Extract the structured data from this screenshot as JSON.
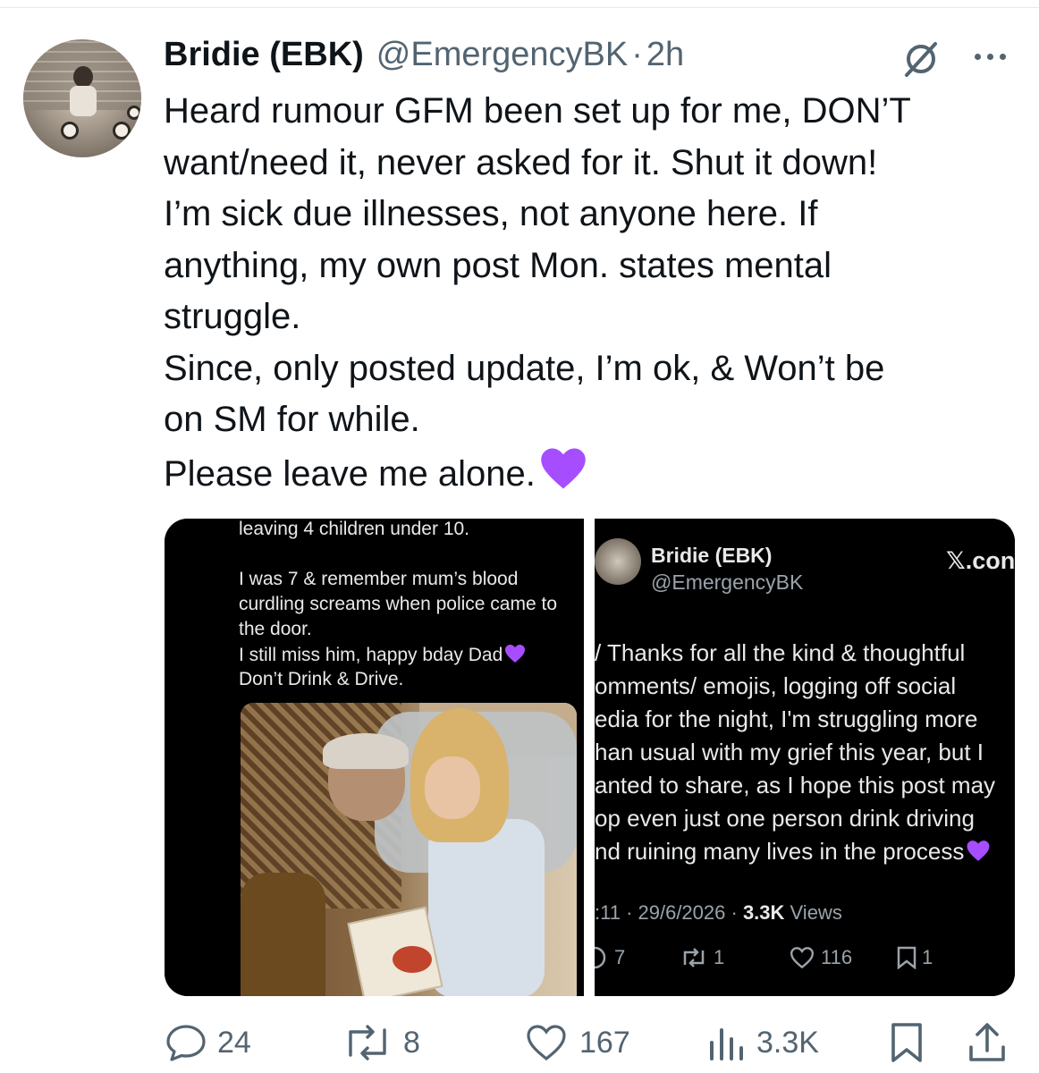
{
  "author": {
    "name": "Bridie (EBK)",
    "handle": "@EmergencyBK",
    "separator": "·",
    "time": "2h"
  },
  "tweet": {
    "lines": [
      "Heard rumour GFM been set up for me, DON’T",
      "want/need it, never asked for it. Shut it down!",
      "I’m sick due illnesses, not anyone here. If",
      "anything, my own post Mon. states mental",
      "struggle.",
      "Since, only posted update, I’m ok, & Won’t be",
      "on SM for while.",
      "Please leave me alone."
    ],
    "emoji": "purple-heart"
  },
  "media": {
    "left": {
      "lines": [
        "leaving 4 children under 10.",
        "I was 7 & remember mum’s blood",
        "curdling screams when police came to",
        "the door.",
        "I still miss him, happy bday Dad",
        "Don’t Drink & Drive."
      ]
    },
    "right": {
      "name": "Bridie (EBK)",
      "handle": "@EmergencyBK",
      "brand": "𝕏.con",
      "lines": [
        "/ Thanks for all the kind & thoughtful",
        "omments/ emojis, logging off social",
        "edia for the night, I'm struggling more",
        "han usual with my grief this year, but I",
        "anted to share, as I hope this post may",
        "op even just one person drink driving",
        "nd ruining many lives in the process"
      ],
      "time": ":11 · 29/6/2026 · ",
      "views_count": "3.3K",
      "views_label": " Views",
      "replies": "7",
      "reposts": "1",
      "likes": "116",
      "bookmarks": "1"
    }
  },
  "actions": {
    "replies": "24",
    "reposts": "8",
    "likes": "167",
    "views": "3.3K"
  },
  "colors": {
    "text": "#0f1419",
    "secondary": "#536471",
    "purple_heart": "#a64dff"
  }
}
